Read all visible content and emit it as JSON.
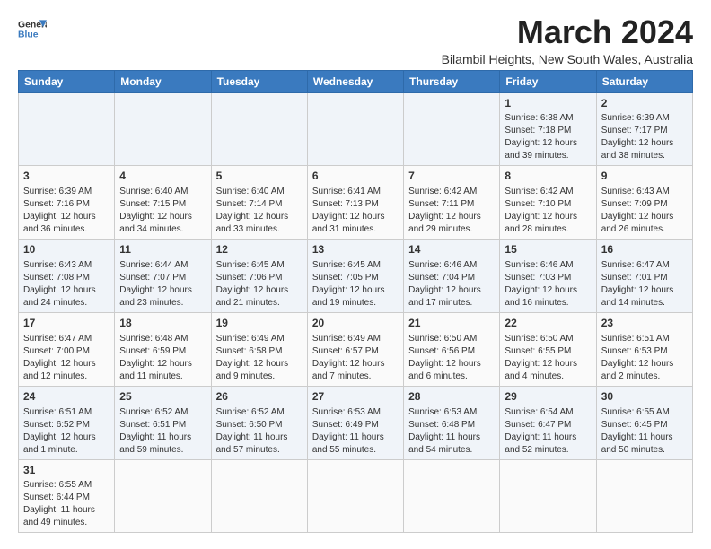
{
  "header": {
    "logo_general": "General",
    "logo_blue": "Blue",
    "month_title": "March 2024",
    "location": "Bilambil Heights, New South Wales, Australia"
  },
  "days_of_week": [
    "Sunday",
    "Monday",
    "Tuesday",
    "Wednesday",
    "Thursday",
    "Friday",
    "Saturday"
  ],
  "weeks": [
    [
      {
        "day": "",
        "info": ""
      },
      {
        "day": "",
        "info": ""
      },
      {
        "day": "",
        "info": ""
      },
      {
        "day": "",
        "info": ""
      },
      {
        "day": "",
        "info": ""
      },
      {
        "day": "1",
        "info": "Sunrise: 6:38 AM\nSunset: 7:18 PM\nDaylight: 12 hours and 39 minutes."
      },
      {
        "day": "2",
        "info": "Sunrise: 6:39 AM\nSunset: 7:17 PM\nDaylight: 12 hours and 38 minutes."
      }
    ],
    [
      {
        "day": "3",
        "info": "Sunrise: 6:39 AM\nSunset: 7:16 PM\nDaylight: 12 hours and 36 minutes."
      },
      {
        "day": "4",
        "info": "Sunrise: 6:40 AM\nSunset: 7:15 PM\nDaylight: 12 hours and 34 minutes."
      },
      {
        "day": "5",
        "info": "Sunrise: 6:40 AM\nSunset: 7:14 PM\nDaylight: 12 hours and 33 minutes."
      },
      {
        "day": "6",
        "info": "Sunrise: 6:41 AM\nSunset: 7:13 PM\nDaylight: 12 hours and 31 minutes."
      },
      {
        "day": "7",
        "info": "Sunrise: 6:42 AM\nSunset: 7:11 PM\nDaylight: 12 hours and 29 minutes."
      },
      {
        "day": "8",
        "info": "Sunrise: 6:42 AM\nSunset: 7:10 PM\nDaylight: 12 hours and 28 minutes."
      },
      {
        "day": "9",
        "info": "Sunrise: 6:43 AM\nSunset: 7:09 PM\nDaylight: 12 hours and 26 minutes."
      }
    ],
    [
      {
        "day": "10",
        "info": "Sunrise: 6:43 AM\nSunset: 7:08 PM\nDaylight: 12 hours and 24 minutes."
      },
      {
        "day": "11",
        "info": "Sunrise: 6:44 AM\nSunset: 7:07 PM\nDaylight: 12 hours and 23 minutes."
      },
      {
        "day": "12",
        "info": "Sunrise: 6:45 AM\nSunset: 7:06 PM\nDaylight: 12 hours and 21 minutes."
      },
      {
        "day": "13",
        "info": "Sunrise: 6:45 AM\nSunset: 7:05 PM\nDaylight: 12 hours and 19 minutes."
      },
      {
        "day": "14",
        "info": "Sunrise: 6:46 AM\nSunset: 7:04 PM\nDaylight: 12 hours and 17 minutes."
      },
      {
        "day": "15",
        "info": "Sunrise: 6:46 AM\nSunset: 7:03 PM\nDaylight: 12 hours and 16 minutes."
      },
      {
        "day": "16",
        "info": "Sunrise: 6:47 AM\nSunset: 7:01 PM\nDaylight: 12 hours and 14 minutes."
      }
    ],
    [
      {
        "day": "17",
        "info": "Sunrise: 6:47 AM\nSunset: 7:00 PM\nDaylight: 12 hours and 12 minutes."
      },
      {
        "day": "18",
        "info": "Sunrise: 6:48 AM\nSunset: 6:59 PM\nDaylight: 12 hours and 11 minutes."
      },
      {
        "day": "19",
        "info": "Sunrise: 6:49 AM\nSunset: 6:58 PM\nDaylight: 12 hours and 9 minutes."
      },
      {
        "day": "20",
        "info": "Sunrise: 6:49 AM\nSunset: 6:57 PM\nDaylight: 12 hours and 7 minutes."
      },
      {
        "day": "21",
        "info": "Sunrise: 6:50 AM\nSunset: 6:56 PM\nDaylight: 12 hours and 6 minutes."
      },
      {
        "day": "22",
        "info": "Sunrise: 6:50 AM\nSunset: 6:55 PM\nDaylight: 12 hours and 4 minutes."
      },
      {
        "day": "23",
        "info": "Sunrise: 6:51 AM\nSunset: 6:53 PM\nDaylight: 12 hours and 2 minutes."
      }
    ],
    [
      {
        "day": "24",
        "info": "Sunrise: 6:51 AM\nSunset: 6:52 PM\nDaylight: 12 hours and 1 minute."
      },
      {
        "day": "25",
        "info": "Sunrise: 6:52 AM\nSunset: 6:51 PM\nDaylight: 11 hours and 59 minutes."
      },
      {
        "day": "26",
        "info": "Sunrise: 6:52 AM\nSunset: 6:50 PM\nDaylight: 11 hours and 57 minutes."
      },
      {
        "day": "27",
        "info": "Sunrise: 6:53 AM\nSunset: 6:49 PM\nDaylight: 11 hours and 55 minutes."
      },
      {
        "day": "28",
        "info": "Sunrise: 6:53 AM\nSunset: 6:48 PM\nDaylight: 11 hours and 54 minutes."
      },
      {
        "day": "29",
        "info": "Sunrise: 6:54 AM\nSunset: 6:47 PM\nDaylight: 11 hours and 52 minutes."
      },
      {
        "day": "30",
        "info": "Sunrise: 6:55 AM\nSunset: 6:45 PM\nDaylight: 11 hours and 50 minutes."
      }
    ],
    [
      {
        "day": "31",
        "info": "Sunrise: 6:55 AM\nSunset: 6:44 PM\nDaylight: 11 hours and 49 minutes."
      },
      {
        "day": "",
        "info": ""
      },
      {
        "day": "",
        "info": ""
      },
      {
        "day": "",
        "info": ""
      },
      {
        "day": "",
        "info": ""
      },
      {
        "day": "",
        "info": ""
      },
      {
        "day": "",
        "info": ""
      }
    ]
  ]
}
